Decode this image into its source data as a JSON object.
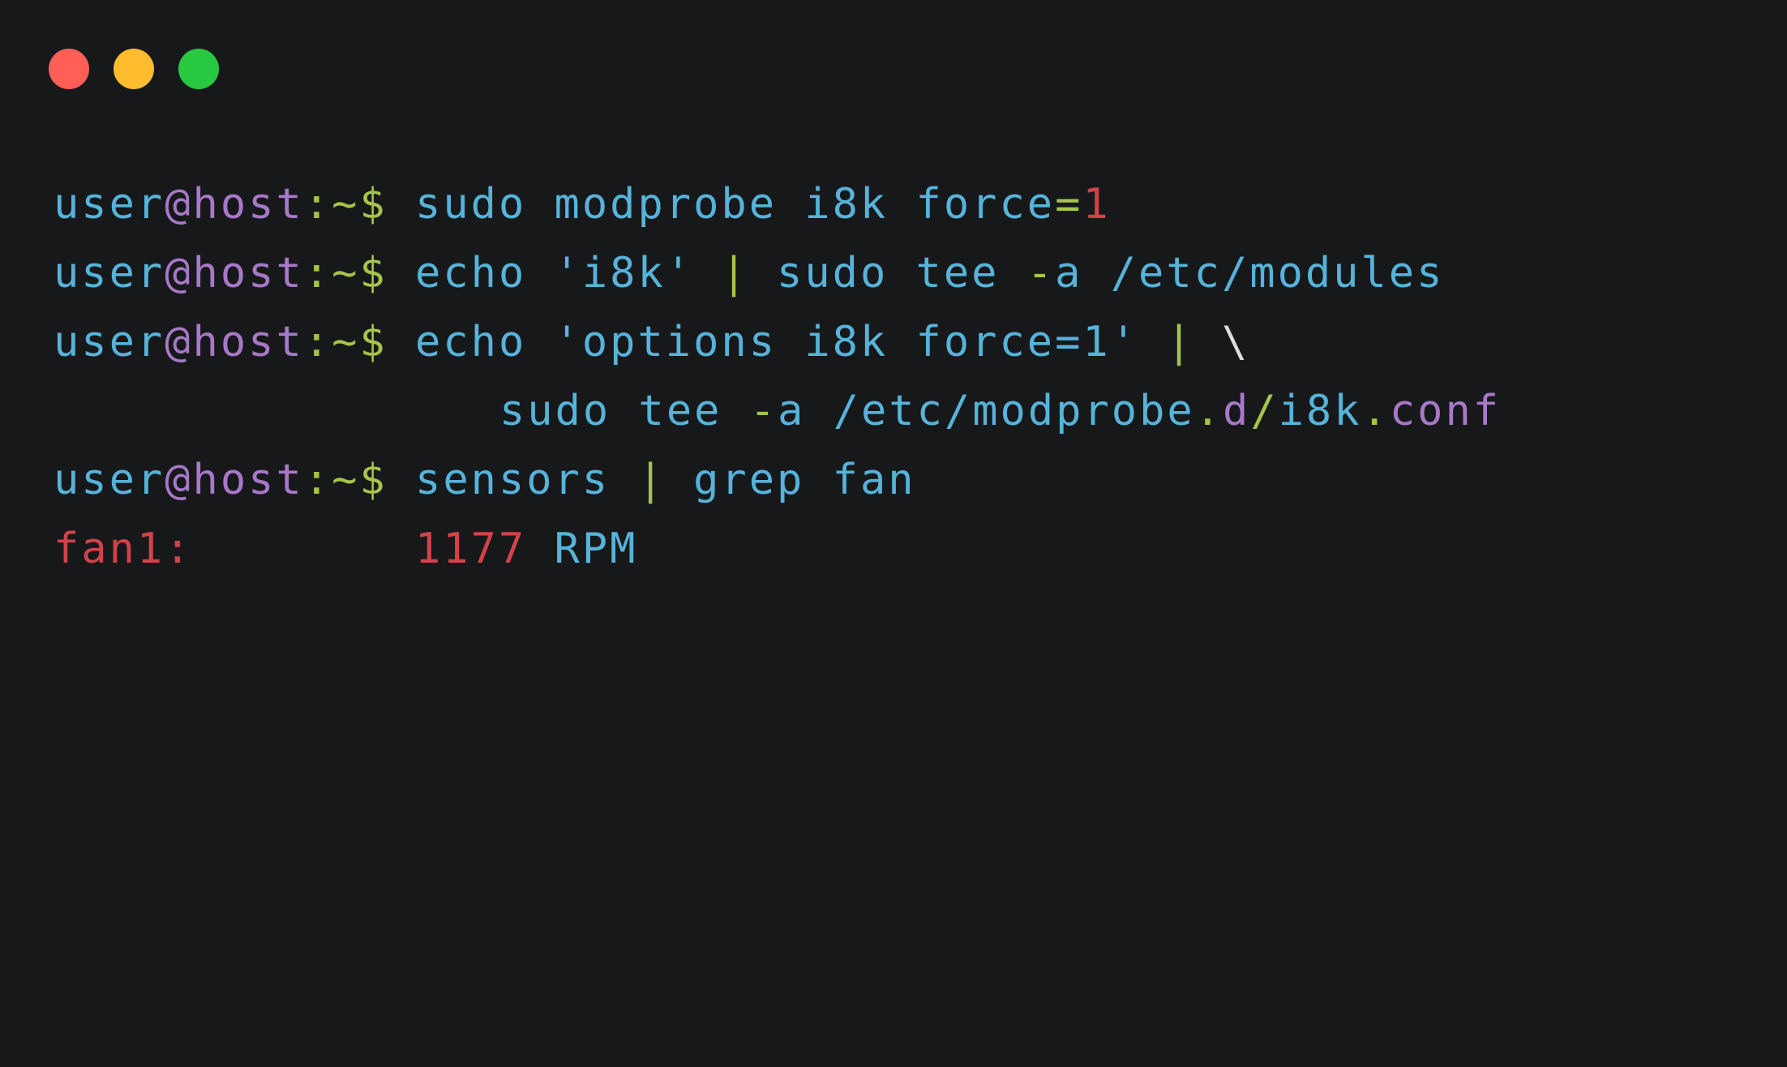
{
  "window": {
    "controls": {
      "close_color": "#ff5f57",
      "minimize_color": "#febc2e",
      "maximize_color": "#28c840"
    }
  },
  "colors": {
    "background": "#17181a",
    "blue": "#56b3da",
    "purple": "#a878c8",
    "green": "#a4c44a",
    "red": "#d2424b",
    "white": "#dcdcdc"
  },
  "prompt": {
    "user": "user",
    "at": "@",
    "host": "host",
    "colon": ":",
    "path_symbol": "~$"
  },
  "lines": [
    {
      "kind": "command",
      "segments": [
        {
          "text": " sudo modprobe i8k force",
          "color": "blue"
        },
        {
          "text": "=",
          "color": "green"
        },
        {
          "text": "1",
          "color": "red"
        }
      ]
    },
    {
      "kind": "command",
      "segments": [
        {
          "text": " echo 'i8k' ",
          "color": "blue"
        },
        {
          "text": "|",
          "color": "green"
        },
        {
          "text": " sudo tee ",
          "color": "blue"
        },
        {
          "text": "-",
          "color": "green"
        },
        {
          "text": "a /etc/modules",
          "color": "blue"
        }
      ]
    },
    {
      "kind": "command",
      "segments": [
        {
          "text": " echo 'options i8k force=1' ",
          "color": "blue"
        },
        {
          "text": "|",
          "color": "green"
        },
        {
          "text": " \\",
          "color": "white"
        }
      ]
    },
    {
      "kind": "continuation",
      "segments": [
        {
          "text": "sudo tee ",
          "color": "blue"
        },
        {
          "text": "-",
          "color": "green"
        },
        {
          "text": "a /etc/modprobe",
          "color": "blue"
        },
        {
          "text": ".",
          "color": "green"
        },
        {
          "text": "d",
          "color": "purple"
        },
        {
          "text": "/",
          "color": "green"
        },
        {
          "text": "i8k",
          "color": "blue"
        },
        {
          "text": ".",
          "color": "green"
        },
        {
          "text": "conf",
          "color": "purple"
        }
      ]
    },
    {
      "kind": "command",
      "segments": [
        {
          "text": " sensors ",
          "color": "blue"
        },
        {
          "text": "|",
          "color": "green"
        },
        {
          "text": " grep fan",
          "color": "blue"
        }
      ]
    },
    {
      "kind": "output",
      "segments": [
        {
          "text": "fan1:        ",
          "color": "red"
        },
        {
          "text": "1177",
          "color": "red"
        },
        {
          "text": " RPM",
          "color": "blue"
        }
      ]
    }
  ]
}
